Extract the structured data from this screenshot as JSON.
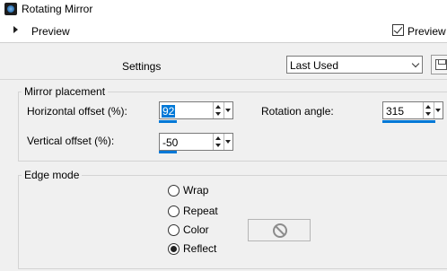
{
  "window": {
    "title": "Rotating Mirror"
  },
  "preview_bar": {
    "toggle_label": "Preview",
    "checkbox_label": "Preview o",
    "checkbox_checked": true
  },
  "settings": {
    "label": "Settings",
    "selected": "Last Used"
  },
  "mirror_placement": {
    "legend": "Mirror placement",
    "horizontal_offset": {
      "label": "Horizontal offset (%):",
      "value": "92"
    },
    "vertical_offset": {
      "label": "Vertical offset (%):",
      "value": "-50"
    },
    "rotation_angle": {
      "label": "Rotation angle:",
      "value": "315"
    }
  },
  "edge_mode": {
    "legend": "Edge mode",
    "options": [
      {
        "label": "Wrap",
        "checked": false
      },
      {
        "label": "Repeat",
        "checked": false
      },
      {
        "label": "Color",
        "checked": false
      },
      {
        "label": "Reflect",
        "checked": true
      }
    ],
    "color_swatch_icon": "no-symbol-icon"
  },
  "colors": {
    "accent": "#0078d7",
    "background": "#f0f0f0",
    "title_background": "#ffffff"
  }
}
